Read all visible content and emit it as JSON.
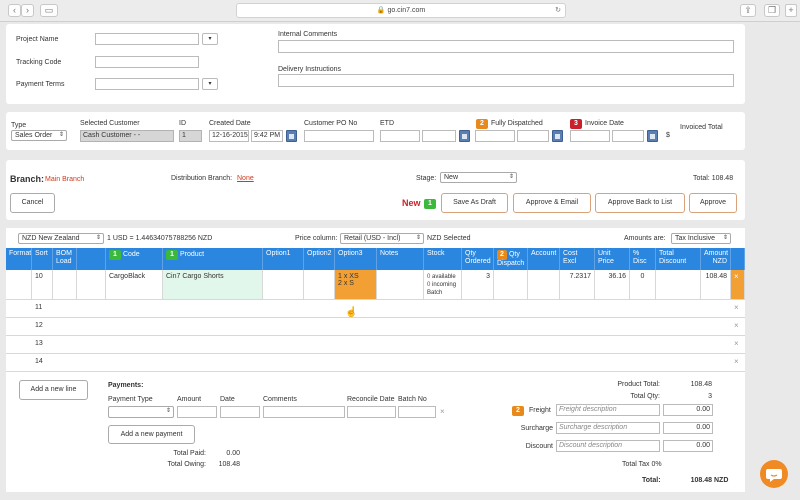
{
  "browser": {
    "url": "go.cin7.com",
    "lock_icon": "lock-icon"
  },
  "top_form": {
    "project_name_label": "Project Name",
    "tracking_code_label": "Tracking Code",
    "payment_terms_label": "Payment Terms",
    "internal_comments_label": "Internal Comments",
    "delivery_instructions_label": "Delivery Instructions"
  },
  "order_header": {
    "type_label": "Type",
    "type_value": "Sales Order",
    "selected_customer_label": "Selected Customer",
    "selected_customer_value": "Cash Customer - -",
    "id_label": "ID",
    "id_value": "1",
    "created_date_label": "Created Date",
    "created_date_value": "12-16-2015",
    "created_time_value": "9:42 PM",
    "customer_po_label": "Customer PO No",
    "etd_label": "ETD",
    "fully_dispatched_badge": "2",
    "fully_dispatched_label": "Fully Dispatched",
    "invoice_date_badge": "3",
    "invoice_date_label": "Invoice Date",
    "invoiced_total_label": "Invoiced Total",
    "invoiced_total_symbol": "$"
  },
  "branch_bar": {
    "branch_label": "Branch:",
    "branch_value": "Main Branch",
    "distribution_label": "Distribution Branch:",
    "distribution_value": "None",
    "stage_label": "Stage:",
    "stage_value": "New",
    "total_label": "Total:",
    "total_value": "108.48",
    "cancel_label": "Cancel",
    "status_label": "New",
    "step_badge": "1",
    "save_draft_label": "Save As Draft",
    "approve_email_label": "Approve & Email",
    "approve_back_label": "Approve Back to List",
    "approve_label": "Approve"
  },
  "currency_bar": {
    "currency_value": "NZD New Zealand",
    "rate_text": "1 USD = 1.44634075788256 NZD",
    "price_column_label": "Price column:",
    "price_column_value": "Retail (USD - Incl)",
    "selected_text": "NZD Selected",
    "amounts_are_label": "Amounts are:",
    "amounts_are_value": "Tax Inclusive"
  },
  "grid": {
    "headers": {
      "format": "Format",
      "sort": "Sort",
      "bom": "BOM Load",
      "code_badge": "1",
      "code": "Code",
      "product_badge": "1",
      "product": "Product",
      "option1": "Option1",
      "option2": "Option2",
      "option3": "Option3",
      "notes": "Notes",
      "stock": "Stock",
      "qty_ordered": "Qty Ordered",
      "qty_dispatch_badge": "2",
      "qty_dispatch": "Qty Dispatch",
      "account": "Account",
      "cost_excl": "Cost Excl",
      "unit_price": "Unit Price",
      "pct_disc": "% Disc",
      "total_discount": "Total Discount",
      "amount_nzd": "Amount NZD"
    },
    "row1": {
      "sort": "10",
      "code": "CargoBlack",
      "product": "Cin7 Cargo Shorts",
      "option3_line1": "1 x XS",
      "option3_line2": "2 x S",
      "stock_available_num": "0",
      "stock_available": "available",
      "stock_incoming_num": "0",
      "stock_incoming": "incoming",
      "stock_batch": "Batch",
      "qty_ordered": "3",
      "cost_excl": "7.2317",
      "unit_price": "36.16",
      "pct_disc": "0",
      "amount": "108.48"
    },
    "empty_rows": [
      "11",
      "12",
      "13",
      "14"
    ]
  },
  "payments": {
    "add_line_label": "Add a new line",
    "title": "Payments:",
    "type_label": "Payment Type",
    "amount_label": "Amount",
    "date_label": "Date",
    "comments_label": "Comments",
    "reconcile_label": "Reconcile Date",
    "batch_label": "Batch No",
    "add_payment_label": "Add a new payment",
    "total_paid_label": "Total Paid:",
    "total_paid_value": "0.00",
    "total_owing_label": "Total Owing:",
    "total_owing_value": "108.48"
  },
  "totals": {
    "product_total_label": "Product Total:",
    "product_total_value": "108.48",
    "total_qty_label": "Total Qty:",
    "total_qty_value": "3",
    "freight_badge": "2",
    "freight_label": "Freight",
    "freight_placeholder": "Freight description",
    "freight_value": "0.00",
    "surcharge_label": "Surcharge",
    "surcharge_placeholder": "Surcharge description",
    "surcharge_value": "0.00",
    "discount_label": "Discount",
    "discount_placeholder": "Discount description",
    "discount_value": "0.00",
    "total_tax_label": "Total Tax 0%",
    "total_label": "Total:",
    "total_value": "108.48",
    "total_currency": "NZD"
  },
  "colors": {
    "accent_blue": "#2a86de",
    "orange": "#e8891c",
    "red": "#c8212c",
    "green": "#3cb83c"
  }
}
